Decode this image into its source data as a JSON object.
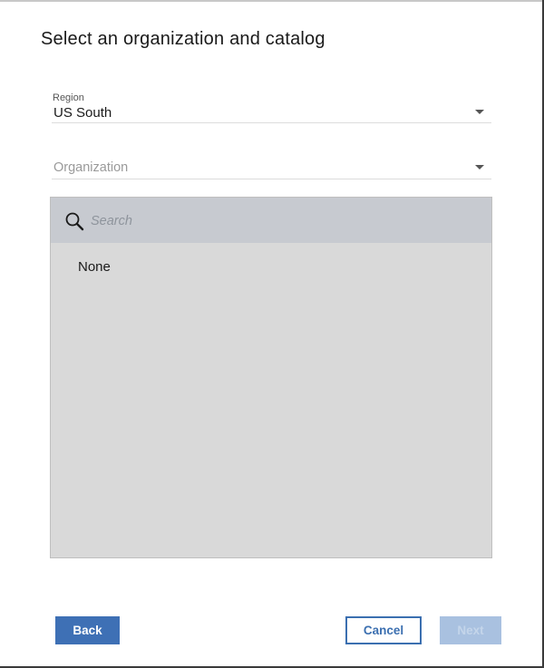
{
  "dialog": {
    "title": "Select an organization and catalog"
  },
  "region": {
    "label": "Region",
    "value": "US South"
  },
  "organization": {
    "placeholder": "Organization"
  },
  "list": {
    "search_placeholder": "Search",
    "items": [
      "None"
    ]
  },
  "buttons": {
    "back": "Back",
    "cancel": "Cancel",
    "next": "Next"
  },
  "colors": {
    "primary": "#3e70b5",
    "disabled": "#a9c1e0",
    "search_bar": "#c7cad0",
    "list_background": "#d9d9d9"
  },
  "icons": {
    "search": "search-icon",
    "dropdown": "chevron-down-icon"
  }
}
